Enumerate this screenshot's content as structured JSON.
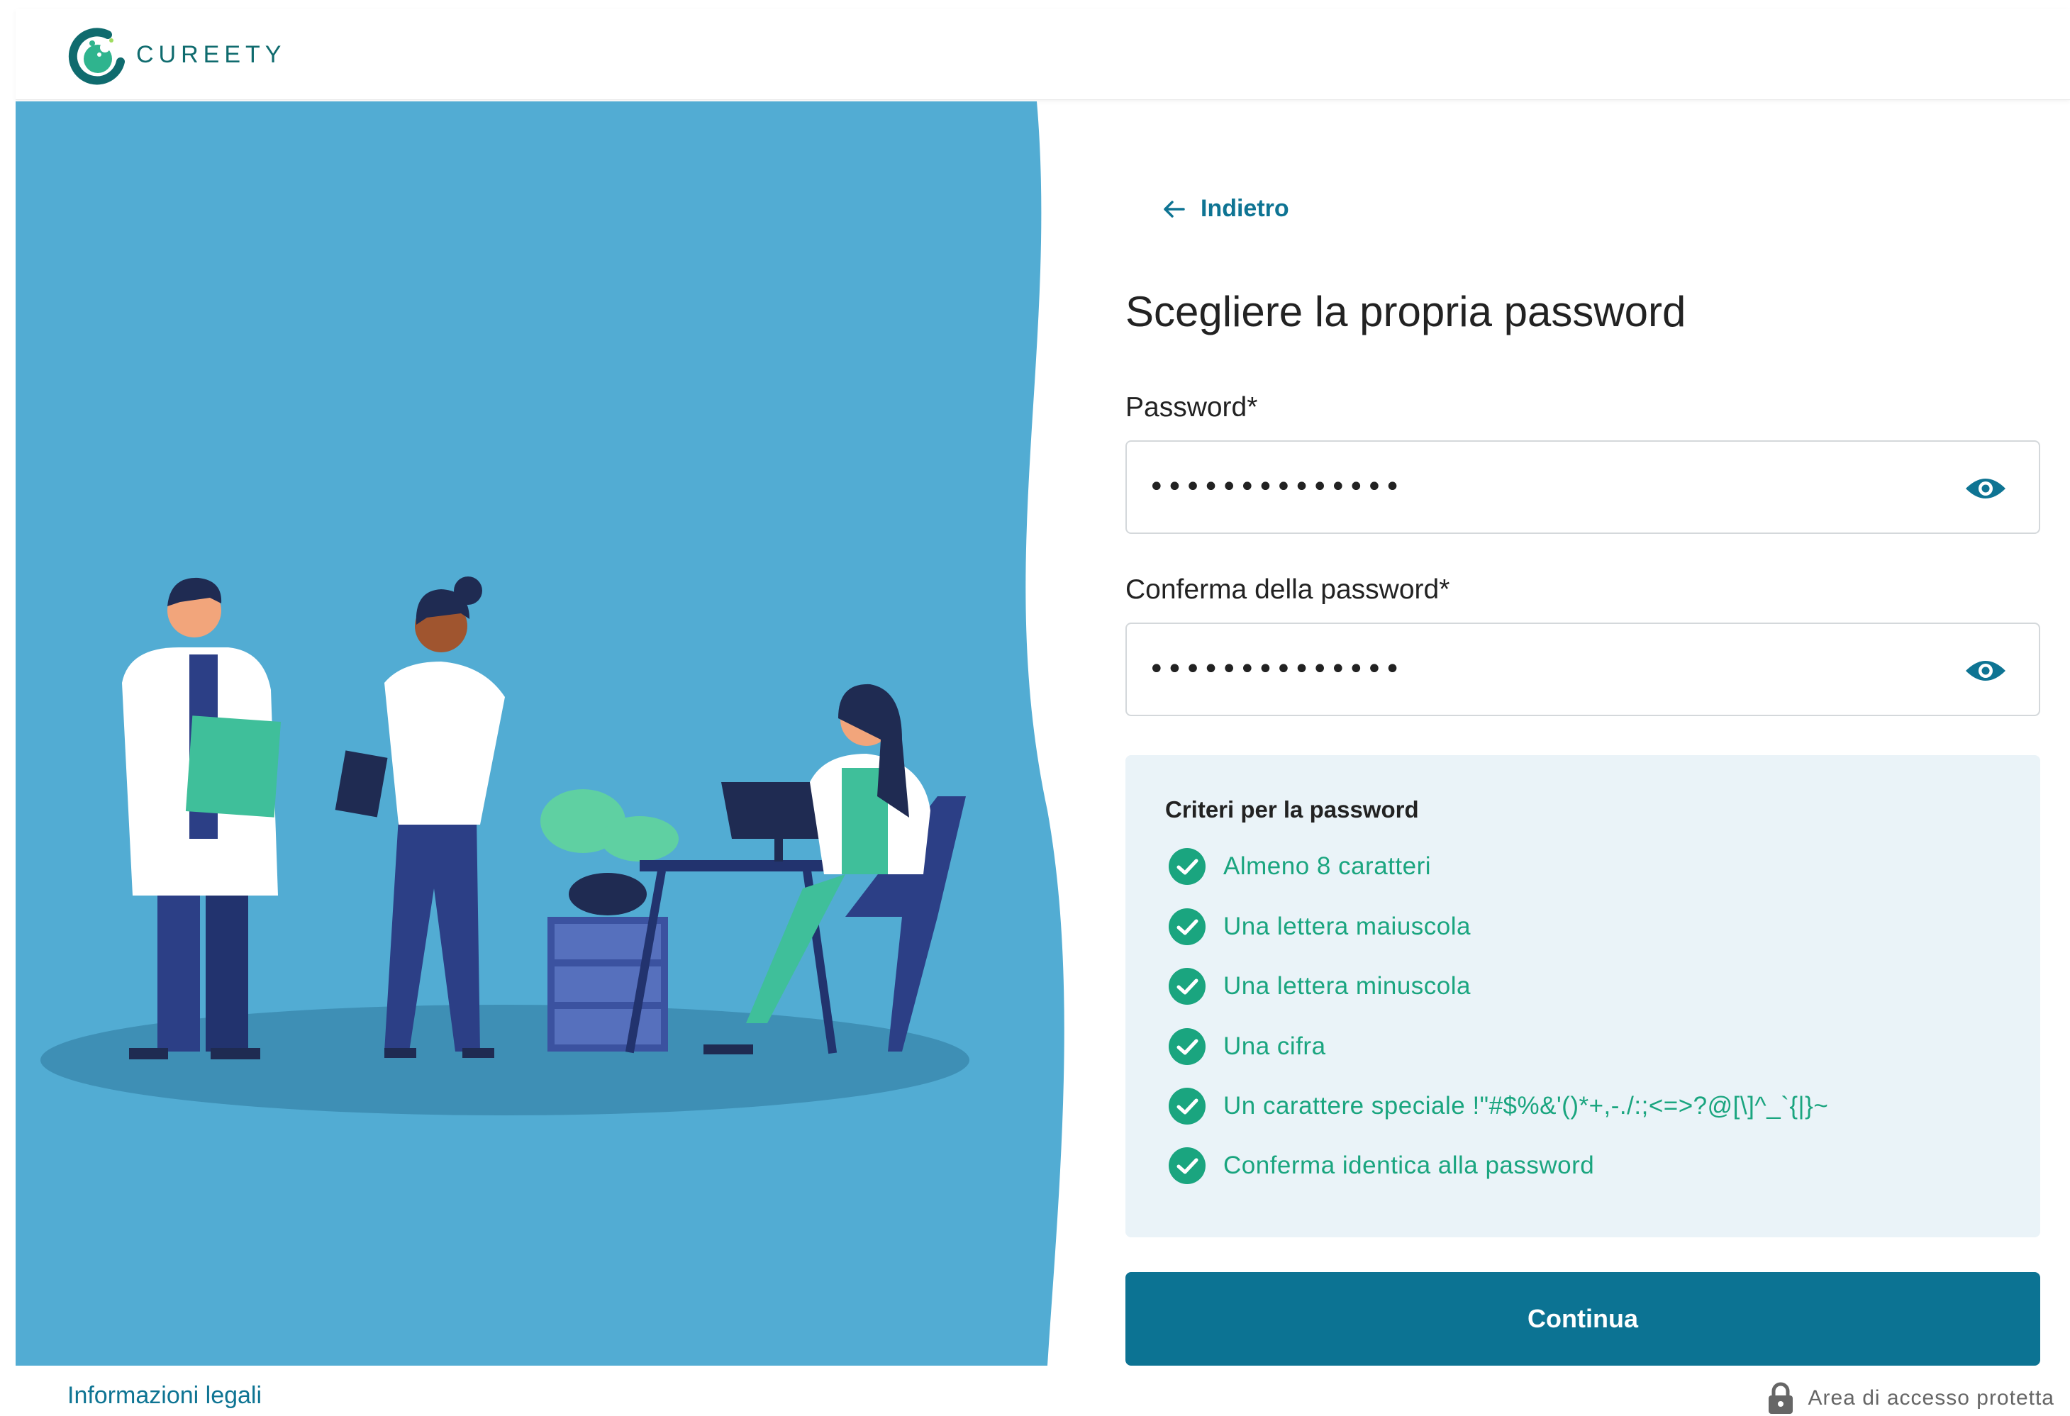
{
  "brand": {
    "name": "CUREETY",
    "accent": "#0c7393",
    "illustration_bg": "#52acd3",
    "success": "#1aa57f"
  },
  "nav": {
    "back_label": "Indietro"
  },
  "form": {
    "title": "Scegliere la propria password",
    "password": {
      "label": "Password*",
      "value": "••••••••••••••",
      "toggle_icon": "eye-icon"
    },
    "confirm": {
      "label": "Conferma della password*",
      "value": "••••••••••••••",
      "toggle_icon": "eye-icon"
    },
    "criteria": {
      "title": "Criteri per la password",
      "items": [
        {
          "label": "Almeno 8 caratteri",
          "met": true
        },
        {
          "label": "Una lettera maiuscola",
          "met": true
        },
        {
          "label": "Una lettera minuscola",
          "met": true
        },
        {
          "label": "Una cifra",
          "met": true
        },
        {
          "label": "Un carattere speciale !\"#$%&'()*+,-./:;<=>?@[\\]^_`{|}~",
          "met": true
        },
        {
          "label": "Conferma identica alla password",
          "met": true
        }
      ]
    },
    "submit_label": "Continua"
  },
  "footer": {
    "legal_label": "Informazioni legali",
    "secure_label": "Area di accesso protetta",
    "secure_icon": "lock-icon"
  }
}
